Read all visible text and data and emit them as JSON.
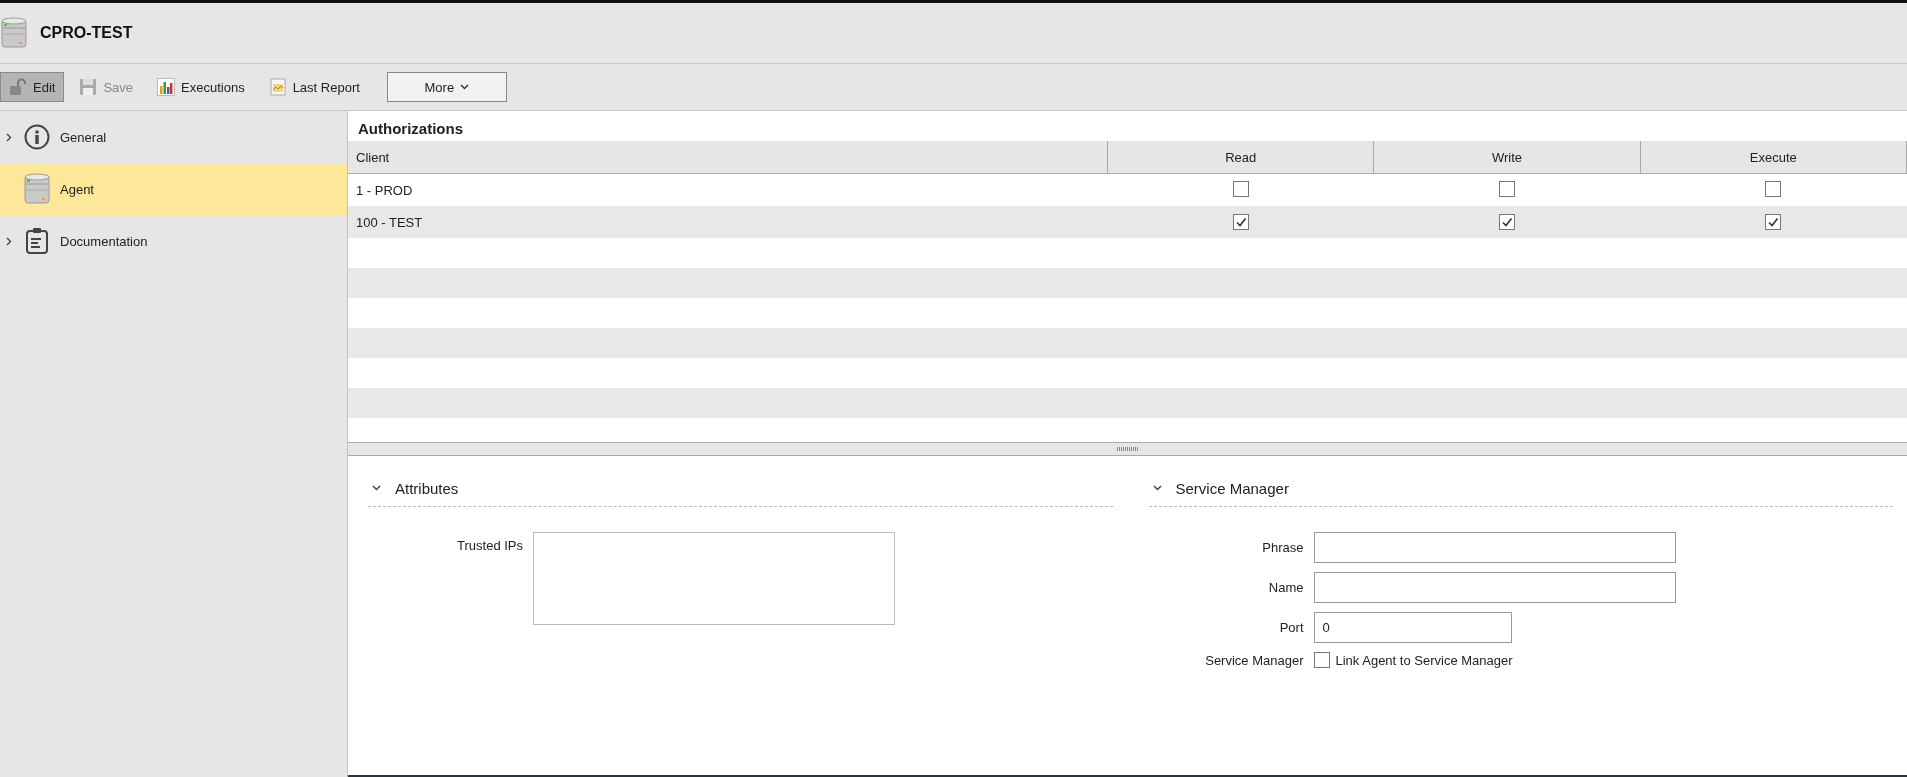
{
  "window": {
    "title": "CPRO-TEST"
  },
  "toolbar": [
    {
      "label": "Edit",
      "kind": "toggle",
      "pressed": true,
      "disabled": false
    },
    {
      "label": "Save",
      "kind": "button",
      "disabled": true
    },
    {
      "label": "Executions",
      "kind": "button",
      "disabled": false
    },
    {
      "label": "Last Report",
      "kind": "button",
      "disabled": false
    },
    {
      "label": "More",
      "kind": "dropdown",
      "disabled": false
    }
  ],
  "sidebar": {
    "items": [
      {
        "label": "General",
        "expandable": true,
        "selected": false
      },
      {
        "label": "Agent",
        "expandable": false,
        "selected": true
      },
      {
        "label": "Documentation",
        "expandable": true,
        "selected": false
      }
    ]
  },
  "authorizations": {
    "title": "Authorizations",
    "columns": [
      "Client",
      "Read",
      "Write",
      "Execute"
    ],
    "rows": [
      {
        "client": "1 - PROD",
        "read": false,
        "write": false,
        "execute": false
      },
      {
        "client": "100 - TEST",
        "read": true,
        "write": true,
        "execute": true
      }
    ]
  },
  "sections": [
    {
      "title": "Attributes",
      "expanded": true,
      "fields": [
        {
          "label": "Trusted IPs",
          "kind": "textarea"
        }
      ]
    },
    {
      "title": "Service Manager",
      "expanded": true,
      "fields": [
        {
          "label": "Phrase",
          "kind": "text"
        },
        {
          "label": "Name",
          "kind": "text"
        },
        {
          "label": "Port",
          "kind": "number",
          "value": "0"
        },
        {
          "label": "Service Manager",
          "kind": "checkbox",
          "checked": false,
          "caption": "Link Agent to Service Manager"
        }
      ]
    }
  ]
}
